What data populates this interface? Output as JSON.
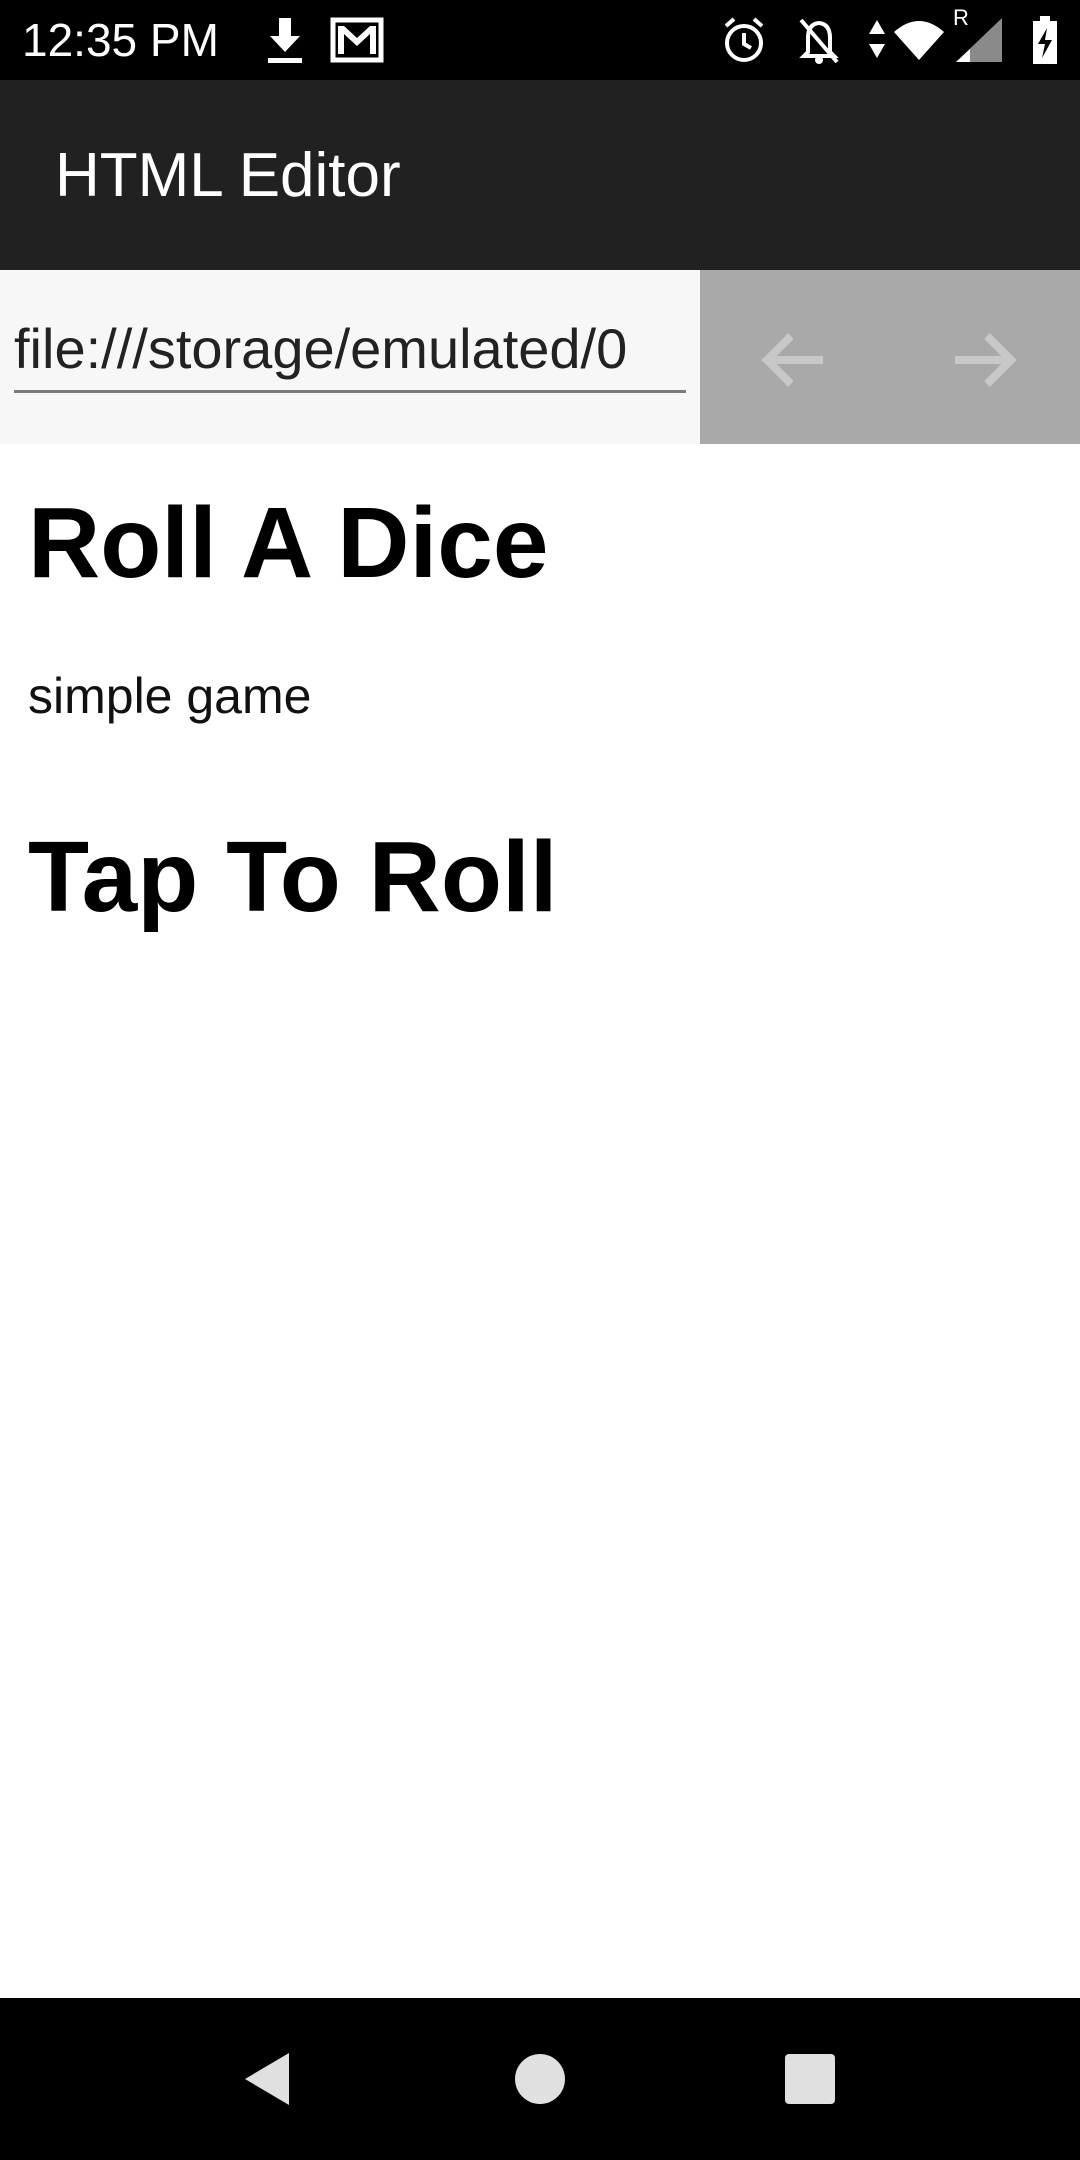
{
  "status_bar": {
    "time": "12:35 PM",
    "icons": [
      "download-icon",
      "gmail-icon",
      "alarm-icon",
      "notifications-off-icon",
      "data-arrows-icon",
      "wifi-icon",
      "signal-icon",
      "battery-charging-icon"
    ],
    "roaming_label": "R"
  },
  "app_bar": {
    "title": "HTML Editor"
  },
  "url_bar": {
    "value": "file:///storage/emulated/0",
    "back_icon": "arrow-left-icon",
    "forward_icon": "arrow-right-icon"
  },
  "page": {
    "heading": "Roll A Dice",
    "subtitle": "simple game",
    "action_heading": "Tap To Roll"
  },
  "nav_bar": {
    "icons": [
      "back-triangle-icon",
      "home-circle-icon",
      "recents-square-icon"
    ]
  },
  "colors": {
    "status_bar": "#000000",
    "app_bar": "#212121",
    "url_bar_bg": "#f7f7f7",
    "nav_box": "#a9a9a9",
    "nav_arrow": "#c8c8c8"
  }
}
